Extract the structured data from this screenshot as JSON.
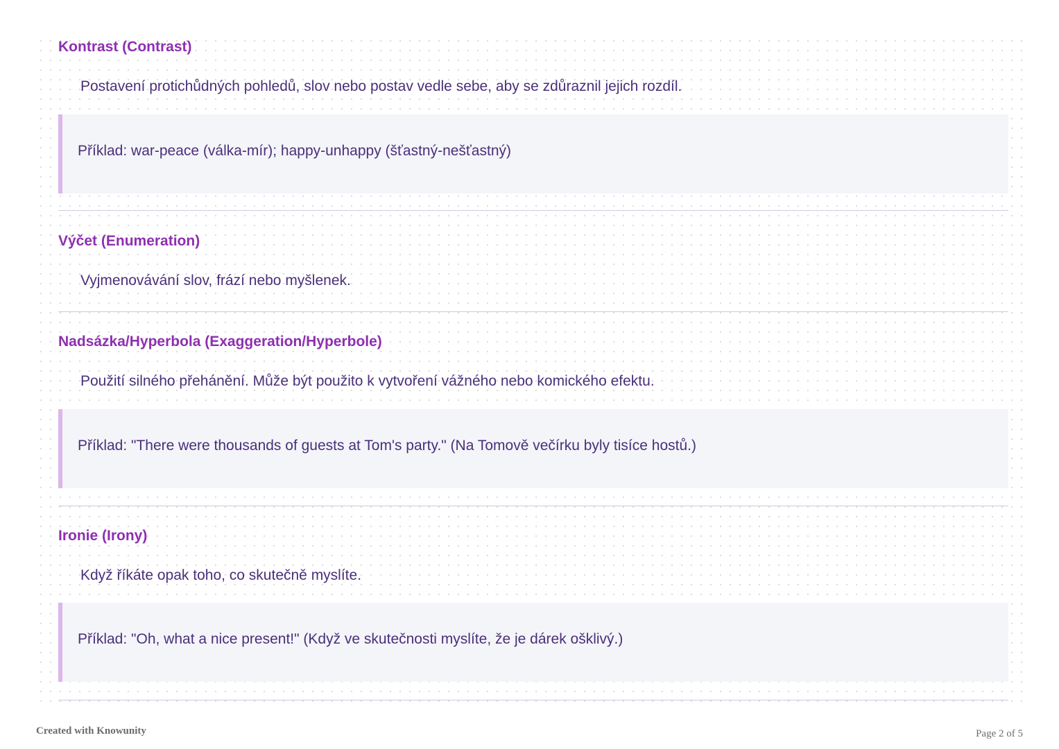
{
  "sections": [
    {
      "title": "Kontrast (Contrast)",
      "description": "Postavení protichůdných pohledů, slov nebo postav vedle sebe, aby se zdůraznil jejich rozdíl.",
      "example": "Příklad: war-peace (válka-mír); happy-unhappy (šťastný-nešťastný)"
    },
    {
      "title": "Výčet (Enumeration)",
      "description": "Vyjmenovávání slov, frází nebo myšlenek."
    },
    {
      "title": "Nadsázka/Hyperbola (Exaggeration/Hyperbole)",
      "description": "Použití silného přehánění. Může být použito k vytvoření vážného nebo komického efektu.",
      "example": "Příklad: \"There were thousands of guests at Tom's party.\" (Na Tomově večírku byly tisíce hostů.)"
    },
    {
      "title": "Ironie (Irony)",
      "description": "Když říkáte opak toho, co skutečně myslíte.",
      "example": "Příklad: \"Oh, what a nice present!\" (Když ve skutečnosti myslíte, že je dárek ošklivý.)"
    }
  ],
  "footer": {
    "created_with": "Created with Knowunity",
    "page_indicator": "Page 2 of 5"
  },
  "colors": {
    "title": "#8e2fb0",
    "body_text": "#4a2f7a",
    "example_background": "#f4f5f9",
    "example_accent": "#dbb7ea",
    "divider": "#c8cde0"
  }
}
